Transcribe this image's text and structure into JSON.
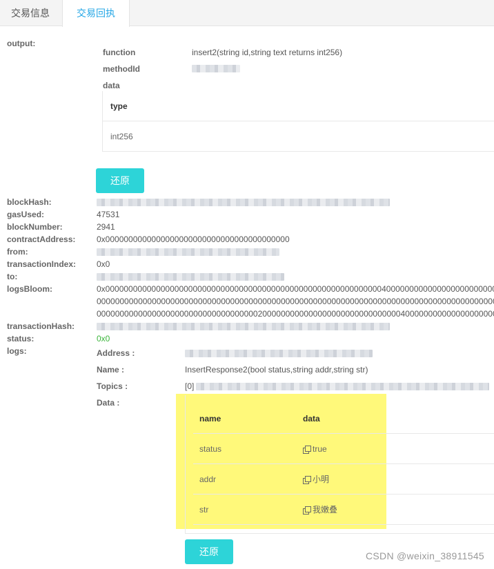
{
  "tabs": [
    {
      "label": "交易信息",
      "active": false
    },
    {
      "label": "交易回执",
      "active": true
    }
  ],
  "output": {
    "label": "output:",
    "function_label": "function",
    "function_value": "insert2(string id,string text returns int256)",
    "methodid_label": "methodId",
    "data_label": "data",
    "table_header": "type",
    "table_row": "int256",
    "restore_label": "还原"
  },
  "fields": {
    "blockHash": "blockHash:",
    "gasUsed": "gasUsed:",
    "gasUsed_value": "47531",
    "blockNumber": "blockNumber:",
    "blockNumber_value": "2941",
    "contractAddress": "contractAddress:",
    "contractAddress_value": "0x0000000000000000000000000000000000000000",
    "from": "from:",
    "transactionIndex": "transactionIndex:",
    "transactionIndex_value": "0x0",
    "to": "to:",
    "logsBloom": "logsBloom:",
    "logsBloom_line1": "0x0000000000000000000000000000000000000000000000000000000000004000000000000000000000000000",
    "logsBloom_line2": "00000000000000000000000000000000000000000000000000000000000000000000000000000000000000000",
    "logsBloom_line3": "000000000000000000000000000000000002000000000000000000000000000000400000000000000000000",
    "transactionHash": "transactionHash:",
    "status": "status:",
    "status_value": "0x0",
    "logs": "logs:"
  },
  "logs": {
    "address_label": "Address :",
    "name_label": "Name :",
    "name_value": "InsertResponse2(bool status,string addr,string str)",
    "topics_label": "Topics :",
    "topics_prefix": "[0]",
    "data_label": "Data :",
    "table_headers": [
      "name",
      "data"
    ],
    "rows": [
      {
        "name": "status",
        "data": "true"
      },
      {
        "name": "addr",
        "data": "小明"
      },
      {
        "name": "str",
        "data": "我嫩叠"
      }
    ],
    "restore_label": "还原"
  },
  "watermark": "CSDN @weixin_38911545",
  "colors": {
    "accent_tab": "#26a7e6",
    "button": "#2dd4d8",
    "highlight": "#fff97a",
    "status_green": "#3bb53b"
  },
  "icons": {
    "copy": "copy-icon"
  }
}
